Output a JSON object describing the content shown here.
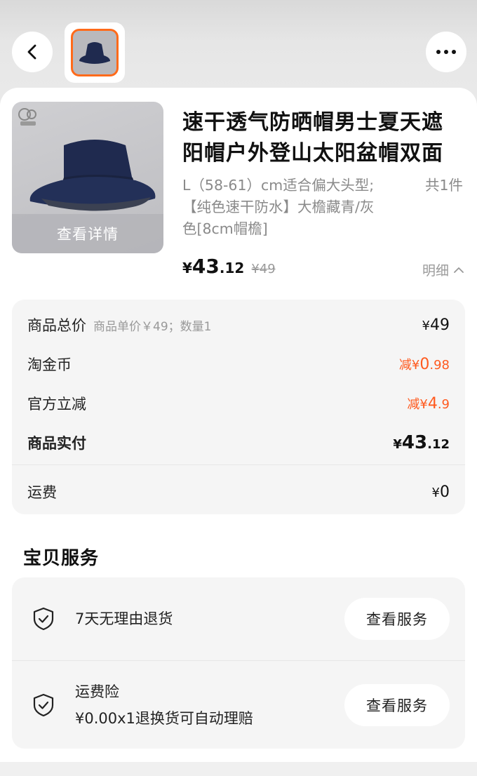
{
  "header": {
    "back_icon": "chevron-left-icon",
    "more_icon": "more-dots-icon"
  },
  "product": {
    "title": "速干透气防晒帽男士夏天遮阳帽户外登山太阳盆帽双面",
    "title_line1": "速干透气防晒帽男士夏天遮",
    "title_line2": "阳帽户外登山太阳盆帽双面",
    "spec_line1": "L（58-61）cm适合偏大头型;",
    "quantity": "共1件",
    "spec_line2": "【纯色速干防水】大檐藏青/灰",
    "spec_line3": "色[8cm帽檐]",
    "view_detail_label": "查看详情",
    "price_symbol": "¥",
    "price_int": "43",
    "price_dec": ".12",
    "original_price": "¥49",
    "detail_toggle_label": "明细",
    "hat_color": "#1f2a4f"
  },
  "breakdown": {
    "rows": [
      {
        "label": "商品总价",
        "sub": "商品单价￥49；数量1",
        "value_symbol": "¥",
        "value": "49"
      },
      {
        "label": "淘金币",
        "value_prefix": "减",
        "value_symbol": "¥",
        "value_int": "0",
        "value_dec": ".98"
      },
      {
        "label": "官方立减",
        "value_prefix": "减",
        "value_symbol": "¥",
        "value_int": "4",
        "value_dec": ".9"
      },
      {
        "label": "商品实付",
        "value_symbol": "¥",
        "value_int": "43",
        "value_dec": ".12"
      },
      {
        "label": "运费",
        "value_symbol": "¥",
        "value": "0"
      }
    ]
  },
  "services": {
    "title": "宝贝服务",
    "items": [
      {
        "icon": "shield-check-icon",
        "label": "7天无理由退货",
        "button": "查看服务"
      },
      {
        "icon": "shield-check-icon",
        "label": "运费险",
        "desc": "¥0.00x1退换货可自动理赔",
        "button": "查看服务"
      }
    ]
  },
  "colors": {
    "accent": "#ff5a1f",
    "thumb_border": "#ff6a1a"
  }
}
